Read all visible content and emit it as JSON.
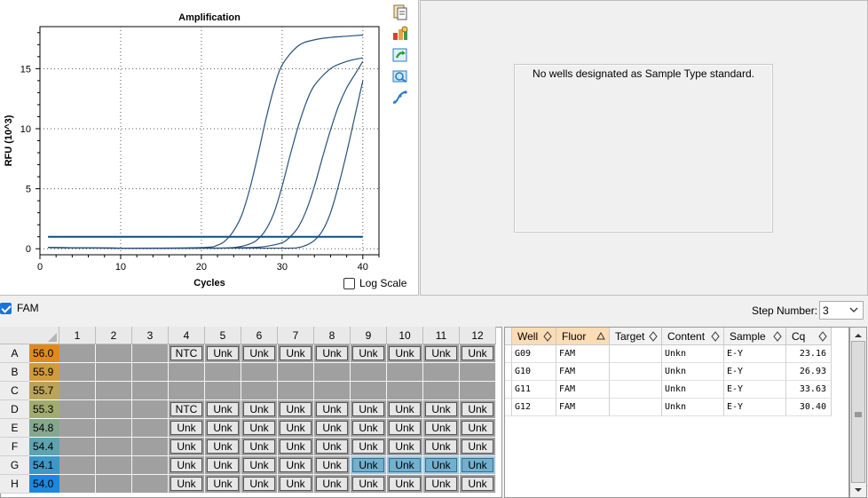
{
  "chart": {
    "title": "Amplification",
    "xlabel": "Cycles",
    "ylabel": "RFU (10^3)",
    "x_ticks": [
      "0",
      "10",
      "20",
      "30",
      "40"
    ],
    "y_ticks": [
      "0",
      "5",
      "10",
      "15"
    ],
    "log_scale_label": "Log Scale",
    "log_scale_checked": false,
    "curve_color": "#27507a",
    "threshold_color": "#0b4f87"
  },
  "chart_data": {
    "type": "line",
    "title": "Amplification",
    "xlabel": "Cycles",
    "ylabel": "RFU (10^3)",
    "xlim": [
      0,
      42
    ],
    "ylim": [
      -0.5,
      18.5
    ],
    "grid": true,
    "threshold": 1.0,
    "series": [
      {
        "x": [
          1,
          10,
          20,
          22,
          23,
          24,
          25,
          26,
          27,
          28,
          29,
          30,
          32,
          34,
          36,
          38,
          40
        ],
        "y": [
          0.1,
          0.05,
          0.1,
          0.3,
          0.7,
          1.5,
          2.8,
          5.0,
          7.8,
          10.8,
          13.4,
          15.3,
          16.9,
          17.4,
          17.6,
          17.7,
          17.8
        ]
      },
      {
        "x": [
          1,
          10,
          20,
          24,
          26,
          27,
          28,
          29,
          30,
          31,
          32,
          33,
          34,
          36,
          38,
          40
        ],
        "y": [
          0.1,
          0.05,
          0.05,
          0.1,
          0.4,
          0.8,
          1.6,
          3.0,
          5.2,
          7.8,
          10.2,
          12.2,
          13.6,
          15.0,
          15.6,
          15.9
        ]
      },
      {
        "x": [
          1,
          10,
          20,
          26,
          28,
          30,
          31,
          32,
          33,
          34,
          35,
          36,
          37,
          38,
          39,
          40
        ],
        "y": [
          0.1,
          0.05,
          0.05,
          0.1,
          0.2,
          0.5,
          1.0,
          1.8,
          3.2,
          5.2,
          7.6,
          9.9,
          11.9,
          13.4,
          14.5,
          15.6
        ]
      },
      {
        "x": [
          1,
          10,
          20,
          30,
          32,
          33,
          34,
          35,
          36,
          37,
          38,
          39,
          40
        ],
        "y": [
          0.1,
          0.05,
          0.05,
          0.05,
          0.1,
          0.3,
          0.7,
          1.5,
          3.0,
          5.3,
          8.0,
          11.0,
          14.0
        ]
      }
    ]
  },
  "standard_curve": {
    "message": "No wells designated as Sample Type standard."
  },
  "fluor_filter": {
    "label": "FAM",
    "checked": true
  },
  "step": {
    "label": "Step Number:",
    "value": "3"
  },
  "plate": {
    "columns": [
      "1",
      "2",
      "3",
      "4",
      "5",
      "6",
      "7",
      "8",
      "9",
      "10",
      "11",
      "12"
    ],
    "rows": [
      {
        "label": "A",
        "temp": "56.0",
        "color": "#e08a1e",
        "wells": [
          "",
          "",
          "",
          "NTC",
          "Unk",
          "Unk",
          "Unk",
          "Unk",
          "Unk",
          "Unk",
          "Unk",
          "Unk"
        ]
      },
      {
        "label": "B",
        "temp": "55.9",
        "color": "#d19a3f",
        "wells": [
          "",
          "",
          "",
          "",
          "",
          "",
          "",
          "",
          "",
          "",
          "",
          ""
        ]
      },
      {
        "label": "C",
        "temp": "55.7",
        "color": "#bba35a",
        "wells": [
          "",
          "",
          "",
          "",
          "",
          "",
          "",
          "",
          "",
          "",
          "",
          ""
        ]
      },
      {
        "label": "D",
        "temp": "55.3",
        "color": "#a2ab6f",
        "wells": [
          "",
          "",
          "",
          "NTC",
          "Unk",
          "Unk",
          "Unk",
          "Unk",
          "Unk",
          "Unk",
          "Unk",
          "Unk"
        ]
      },
      {
        "label": "E",
        "temp": "54.8",
        "color": "#84a88f",
        "wells": [
          "",
          "",
          "",
          "Unk",
          "Unk",
          "Unk",
          "Unk",
          "Unk",
          "Unk",
          "Unk",
          "Unk",
          "Unk"
        ]
      },
      {
        "label": "F",
        "temp": "54.4",
        "color": "#5fa3b0",
        "wells": [
          "",
          "",
          "",
          "Unk",
          "Unk",
          "Unk",
          "Unk",
          "Unk",
          "Unk",
          "Unk",
          "Unk",
          "Unk"
        ]
      },
      {
        "label": "G",
        "temp": "54.1",
        "color": "#3d97c8",
        "wells": [
          "",
          "",
          "",
          "Unk",
          "Unk",
          "Unk",
          "Unk",
          "Unk",
          "Unk",
          "Unk",
          "Unk",
          "Unk"
        ]
      },
      {
        "label": "H",
        "temp": "54.0",
        "color": "#1d87df",
        "wells": [
          "",
          "",
          "",
          "Unk",
          "Unk",
          "Unk",
          "Unk",
          "Unk",
          "Unk",
          "Unk",
          "Unk",
          "Unk"
        ]
      }
    ],
    "selected": [
      [
        "G",
        9
      ],
      [
        "G",
        10
      ],
      [
        "G",
        11
      ],
      [
        "G",
        12
      ]
    ]
  },
  "results_table": {
    "headers": [
      "Well",
      "Fluor",
      "Target",
      "Content",
      "Sample",
      "Cq"
    ],
    "sorted_columns": [
      "Well",
      "Fluor"
    ],
    "rows": [
      [
        "G09",
        "FAM",
        "",
        "Unkn",
        "E-Y",
        "23.16"
      ],
      [
        "G10",
        "FAM",
        "",
        "Unkn",
        "E-Y",
        "26.93"
      ],
      [
        "G11",
        "FAM",
        "",
        "Unkn",
        "E-Y",
        "33.63"
      ],
      [
        "G12",
        "FAM",
        "",
        "Unkn",
        "E-Y",
        "30.40"
      ]
    ]
  },
  "toolbar_icons": [
    "copy-icon",
    "export-icon",
    "refresh-icon",
    "zoom-icon",
    "curve-icon"
  ]
}
